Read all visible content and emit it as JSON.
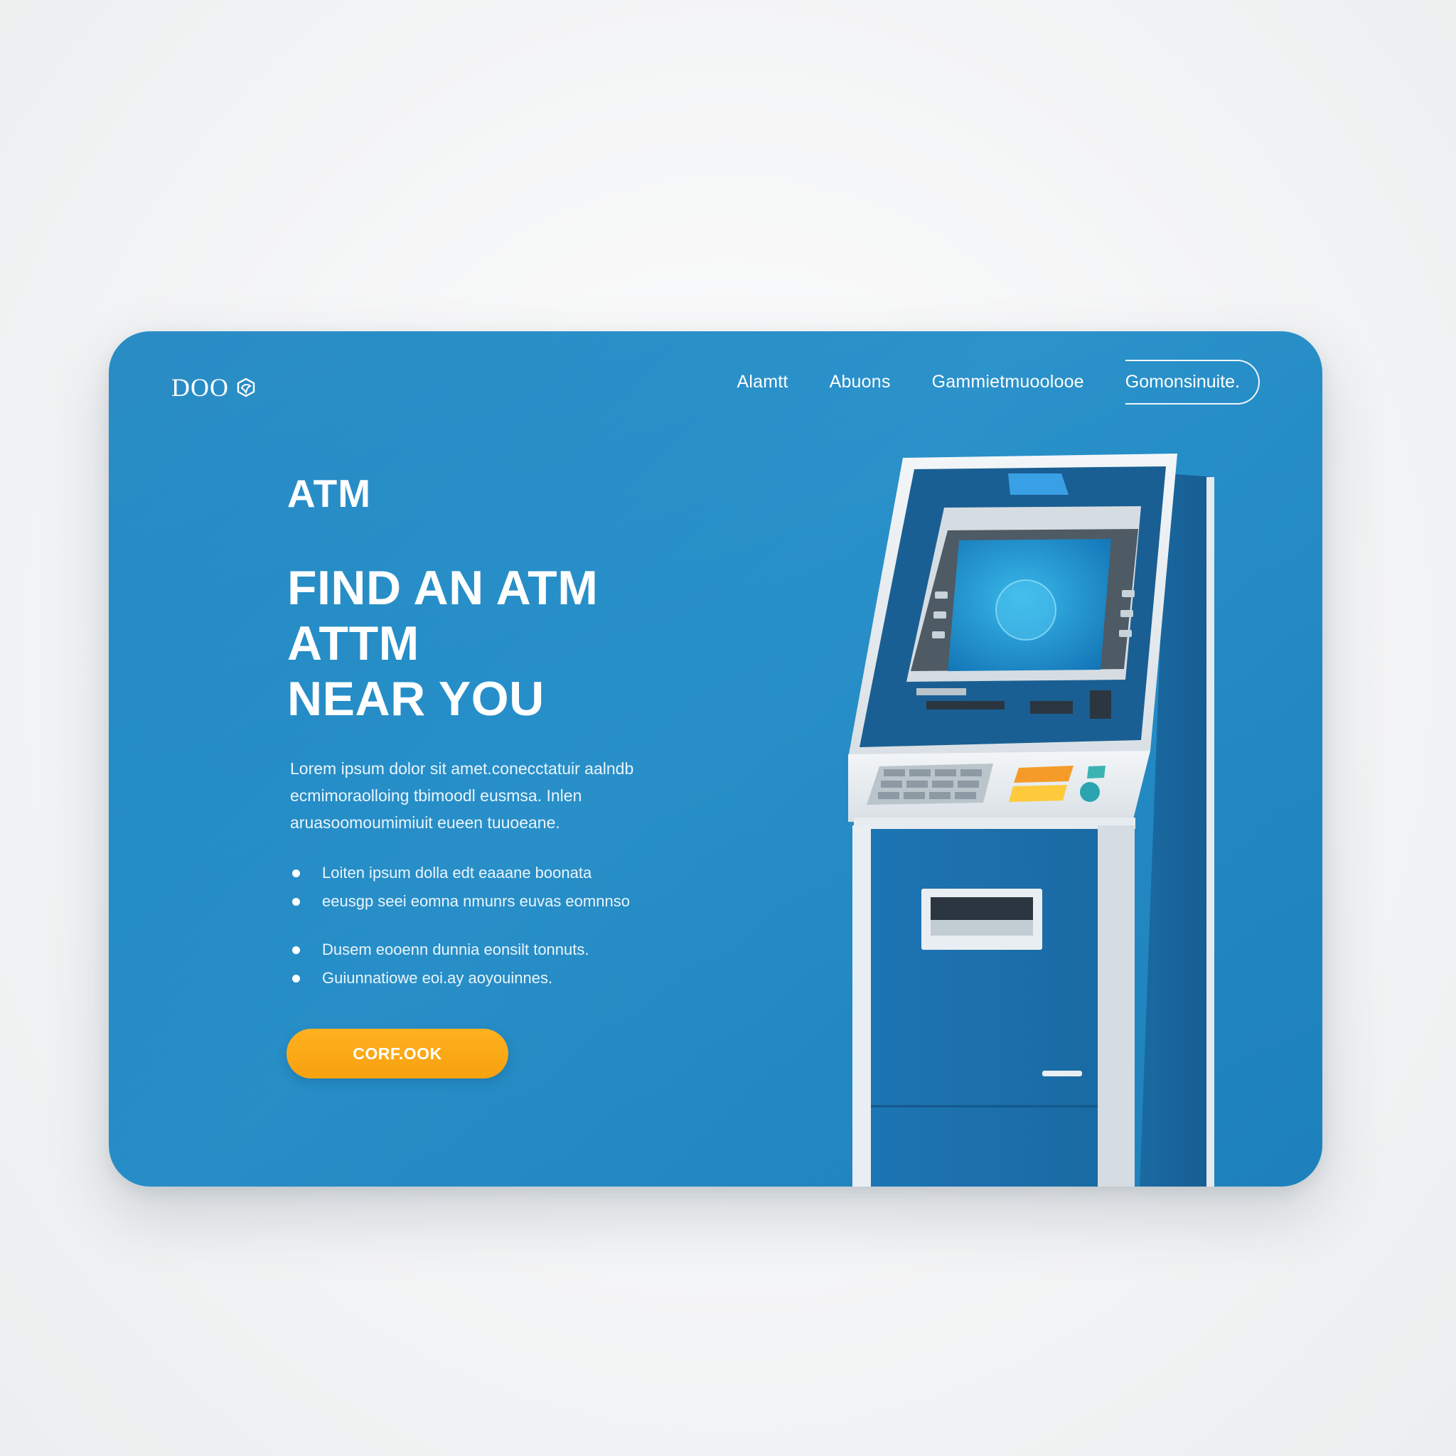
{
  "brand": {
    "logo_text": "DOO"
  },
  "nav": {
    "links": [
      "Alamtt",
      "Abuons",
      "Gammietmuoolooe"
    ],
    "cta_label": "Gomonsinuite."
  },
  "hero": {
    "eyebrow": "ATM",
    "headline": [
      "FIND AN ATM",
      "ATTM",
      "NEAR YOU"
    ],
    "intro": "Lorem ipsum dolor sit amet.conecctatuir aalndb ecmimoraolloing tbimoodl eusmsa. Inlen aruasoomoumimiuit eueen tuuoeane.",
    "bullets": [
      "Loiten ipsum dolla edt eaaane boonata",
      "eeusgp seei eomna nmunrs euvas eomnnso",
      "Dusem eooenn dunnia eonsilt tonnuts.",
      "Guiunnatiowe eoi.ay aoyouinnes."
    ],
    "cta_label": "CORF.OOK"
  },
  "colors": {
    "card_blue": "#2890c9",
    "accent_orange": "#ffb11f",
    "atm_dark_blue": "#1a6aa3",
    "atm_frame": "#e9eef2"
  },
  "icons": {
    "logo_mark": "hexagon-leaf-icon",
    "atm": "atm-machine-illustration"
  }
}
